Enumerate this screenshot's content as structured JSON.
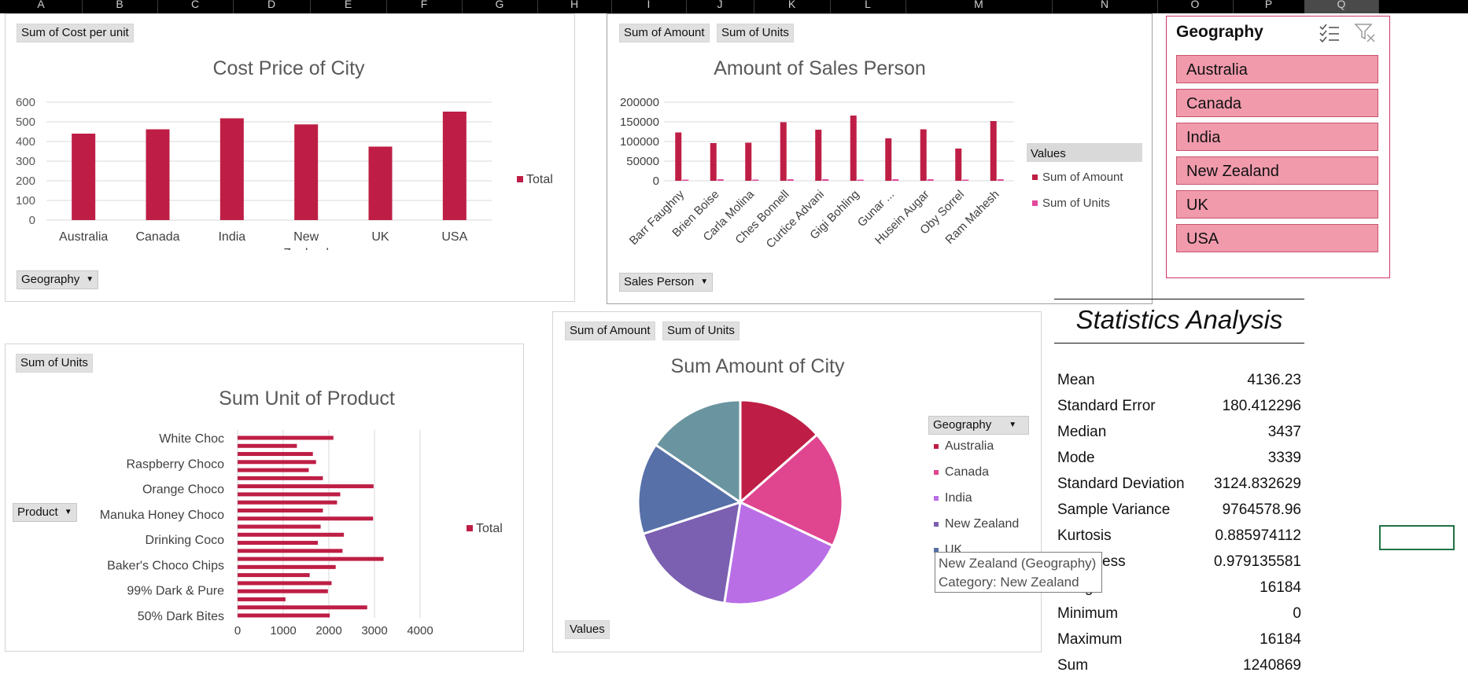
{
  "column_headers": [
    "A",
    "B",
    "C",
    "D",
    "E",
    "F",
    "G",
    "H",
    "I",
    "J",
    "K",
    "L",
    "M",
    "N",
    "O",
    "P",
    "Q"
  ],
  "cost_chart": {
    "field_top": "Sum of Cost per unit",
    "field_bottom": "Geography",
    "legend": "Total",
    "color": "#be1e45",
    "chart_data": {
      "type": "bar",
      "title": "Cost Price of City",
      "categories": [
        "Australia",
        "Canada",
        "India",
        "New Zealand",
        "UK",
        "USA"
      ],
      "category_lines": [
        [
          "Australia"
        ],
        [
          "Canada"
        ],
        [
          "India"
        ],
        [
          "New",
          "Zealand"
        ],
        [
          "UK"
        ],
        [
          "USA"
        ]
      ],
      "series": [
        {
          "name": "Total",
          "values": [
            440,
            462,
            518,
            487,
            374,
            552
          ]
        }
      ],
      "ylim": [
        0,
        600
      ],
      "yticks": [
        "0",
        "100",
        "200",
        "300",
        "400",
        "500",
        "600"
      ],
      "grid": true,
      "legend_position": "right"
    }
  },
  "sales_chart": {
    "field_top_1": "Sum of Amount",
    "field_top_2": "Sum of Units",
    "field_bottom": "Sales Person",
    "legend_title": "Values",
    "colors": [
      "#be1e45",
      "#e0489a"
    ],
    "chart_data": {
      "type": "bar",
      "title": "Amount of Sales Person",
      "categories": [
        "Barr Faughny",
        "Brien Boise",
        "Carla Molina",
        "Ches Bonnell",
        "Curtice Advani",
        "Gigi Bohling",
        "Gunar ...",
        "Husein Augar",
        "Oby Sorrel",
        "Ram Mahesh"
      ],
      "series": [
        {
          "name": "Sum of Amount",
          "values": [
            123000,
            96000,
            97000,
            149000,
            130000,
            166000,
            108000,
            131000,
            82000,
            152000
          ]
        },
        {
          "name": "Sum of Units",
          "values": [
            3000,
            4000,
            3000,
            4000,
            4000,
            3000,
            4000,
            4000,
            3000,
            4000
          ]
        }
      ],
      "ylim": [
        0,
        200000
      ],
      "yticks": [
        "0",
        "50000",
        "100000",
        "150000",
        "200000"
      ],
      "grid": true,
      "legend_position": "right"
    }
  },
  "slicer": {
    "title": "Geography",
    "items": [
      "Australia",
      "Canada",
      "India",
      "New Zealand",
      "UK",
      "USA"
    ],
    "multi_select_icon": "checklist-icon",
    "clear_filter_icon": "filter-clear-icon"
  },
  "units_chart": {
    "field_top": "Sum of Units",
    "field_left": "Product",
    "legend": "Total",
    "color": "#be1e45",
    "chart_data": {
      "type": "bar",
      "orientation": "horizontal",
      "title": "Sum Unit of Product",
      "categories": [
        "50% Dark Bites",
        "",
        "99% Dark & Pure",
        "",
        "Baker's Choco Chips",
        "",
        "Drinking Coco",
        "",
        "Manuka Honey Choco",
        "",
        "Orange Choco",
        "",
        "Raspberry Choco",
        "",
        "White Choc",
        ""
      ],
      "series": [
        {
          "name": "Total",
          "values": [
            2020,
            2840,
            1050,
            1980,
            2060,
            1580,
            2150,
            3200,
            2300,
            1760,
            2330,
            1820,
            2970,
            1870,
            2180,
            2250,
            2980,
            1870,
            1560,
            1720,
            1650,
            1300,
            2100
          ]
        }
      ],
      "xlim": [
        0,
        4000
      ],
      "xticks": [
        "0",
        "1000",
        "2000",
        "3000",
        "4000"
      ],
      "grid": true,
      "legend_position": "right"
    }
  },
  "pie_chart": {
    "field_top_1": "Sum of Amount",
    "field_top_2": "Sum of Units",
    "field_bottom": "Values",
    "legend_field": "Geography",
    "chart_data": {
      "type": "pie",
      "title": "Sum Amount of City",
      "categories": [
        "Australia",
        "Canada",
        "India",
        "New Zealand",
        "UK",
        "USA"
      ],
      "values": [
        13.5,
        18.5,
        20.5,
        17.5,
        14.5,
        15.5
      ],
      "colors": [
        "#be1e45",
        "#e04590",
        "#b96ee6",
        "#7b5fb0",
        "#5770a8",
        "#6a95a0"
      ],
      "legend_visible": [
        "Australia",
        "Canada",
        "India",
        "New Zealand",
        "UK"
      ]
    }
  },
  "tooltip": {
    "line1": "New Zealand (Geography)",
    "line2": "Category: New Zealand"
  },
  "stats": {
    "title": "Statistics Analysis",
    "rows": [
      {
        "label": "Mean",
        "value": "4136.23"
      },
      {
        "label": "Standard Error",
        "value": "180.412296"
      },
      {
        "label": "Median",
        "value": "3437"
      },
      {
        "label": "Mode",
        "value": "3339"
      },
      {
        "label": "Standard Deviation",
        "value": "3124.832629"
      },
      {
        "label": "Sample Variance",
        "value": "9764578.96"
      },
      {
        "label": "Kurtosis",
        "value": "0.885974112"
      },
      {
        "label": "Skewness",
        "value": "0.979135581"
      },
      {
        "label": "Range",
        "value": "16184"
      },
      {
        "label": "Minimum",
        "value": "0"
      },
      {
        "label": "Maximum",
        "value": "16184"
      },
      {
        "label": "Sum",
        "value": "1240869"
      }
    ]
  }
}
